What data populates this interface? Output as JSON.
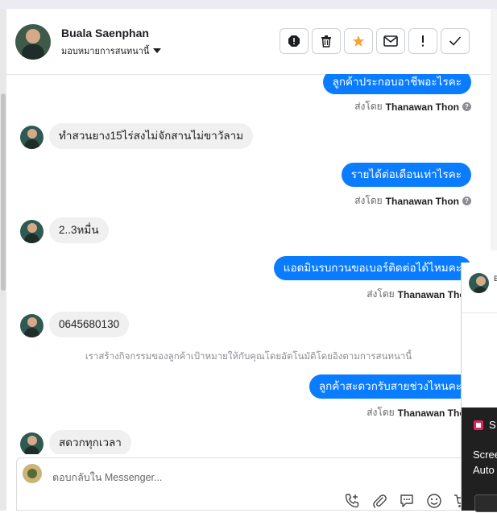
{
  "header": {
    "name": "Buala Saenphan",
    "assign_label": "มอบหมายการสนทนานี้"
  },
  "messages": [
    {
      "dir": "out",
      "text": "ลูกค้าประกอบอาชีพอะไรคะ",
      "sent_by_prefix": "ส่งโดย",
      "sent_by": "Thanawan Thon"
    },
    {
      "dir": "in",
      "text": "ทำสวนยาง15ไร่สงไม่จักสานไม่ขาวัลาม"
    },
    {
      "dir": "out",
      "text": "รายได้ต่อเดือนเท่าไรคะ",
      "sent_by_prefix": "ส่งโดย",
      "sent_by": "Thanawan Thon"
    },
    {
      "dir": "in",
      "text": "2..3หมื่น"
    },
    {
      "dir": "out",
      "text": "แอดมินรบกวนขอเบอร์ติดต่อได้ไหมคะ",
      "sent_by_prefix": "ส่งโดย",
      "sent_by": "Thanawan Thon"
    },
    {
      "dir": "in",
      "text": "0645680130"
    },
    {
      "dir": "system",
      "text": "เราสร้างกิจกรรมของลูกค้าเป้าหมายให้กับคุณโดยอัตโนมัติโดยอิงตามการสนทนานี้"
    },
    {
      "dir": "out",
      "text": "ลูกค้าสะดวกรับสายช่วงไหนคะ",
      "sent_by_prefix": "ส่งโดย",
      "sent_by": "Thanawan Thon"
    },
    {
      "dir": "in",
      "text": "สดวกทุกเวลา"
    }
  ],
  "composer": {
    "placeholder": "ตอบกลับใน Messenger..."
  },
  "popup": {
    "name_fragment": "B",
    "line1": "S",
    "line2": "Scree",
    "line3": "Auto"
  },
  "colors": {
    "accent": "#0a7cff",
    "incoming_bubble": "#f0f0f0",
    "star": "#f7a531"
  },
  "icons": [
    "alert-icon",
    "trash-icon",
    "star-icon",
    "mail-icon",
    "exclamation-icon",
    "check-icon",
    "phone-add-icon",
    "attach-icon",
    "chat-icon",
    "emoji-icon",
    "cart-icon"
  ]
}
